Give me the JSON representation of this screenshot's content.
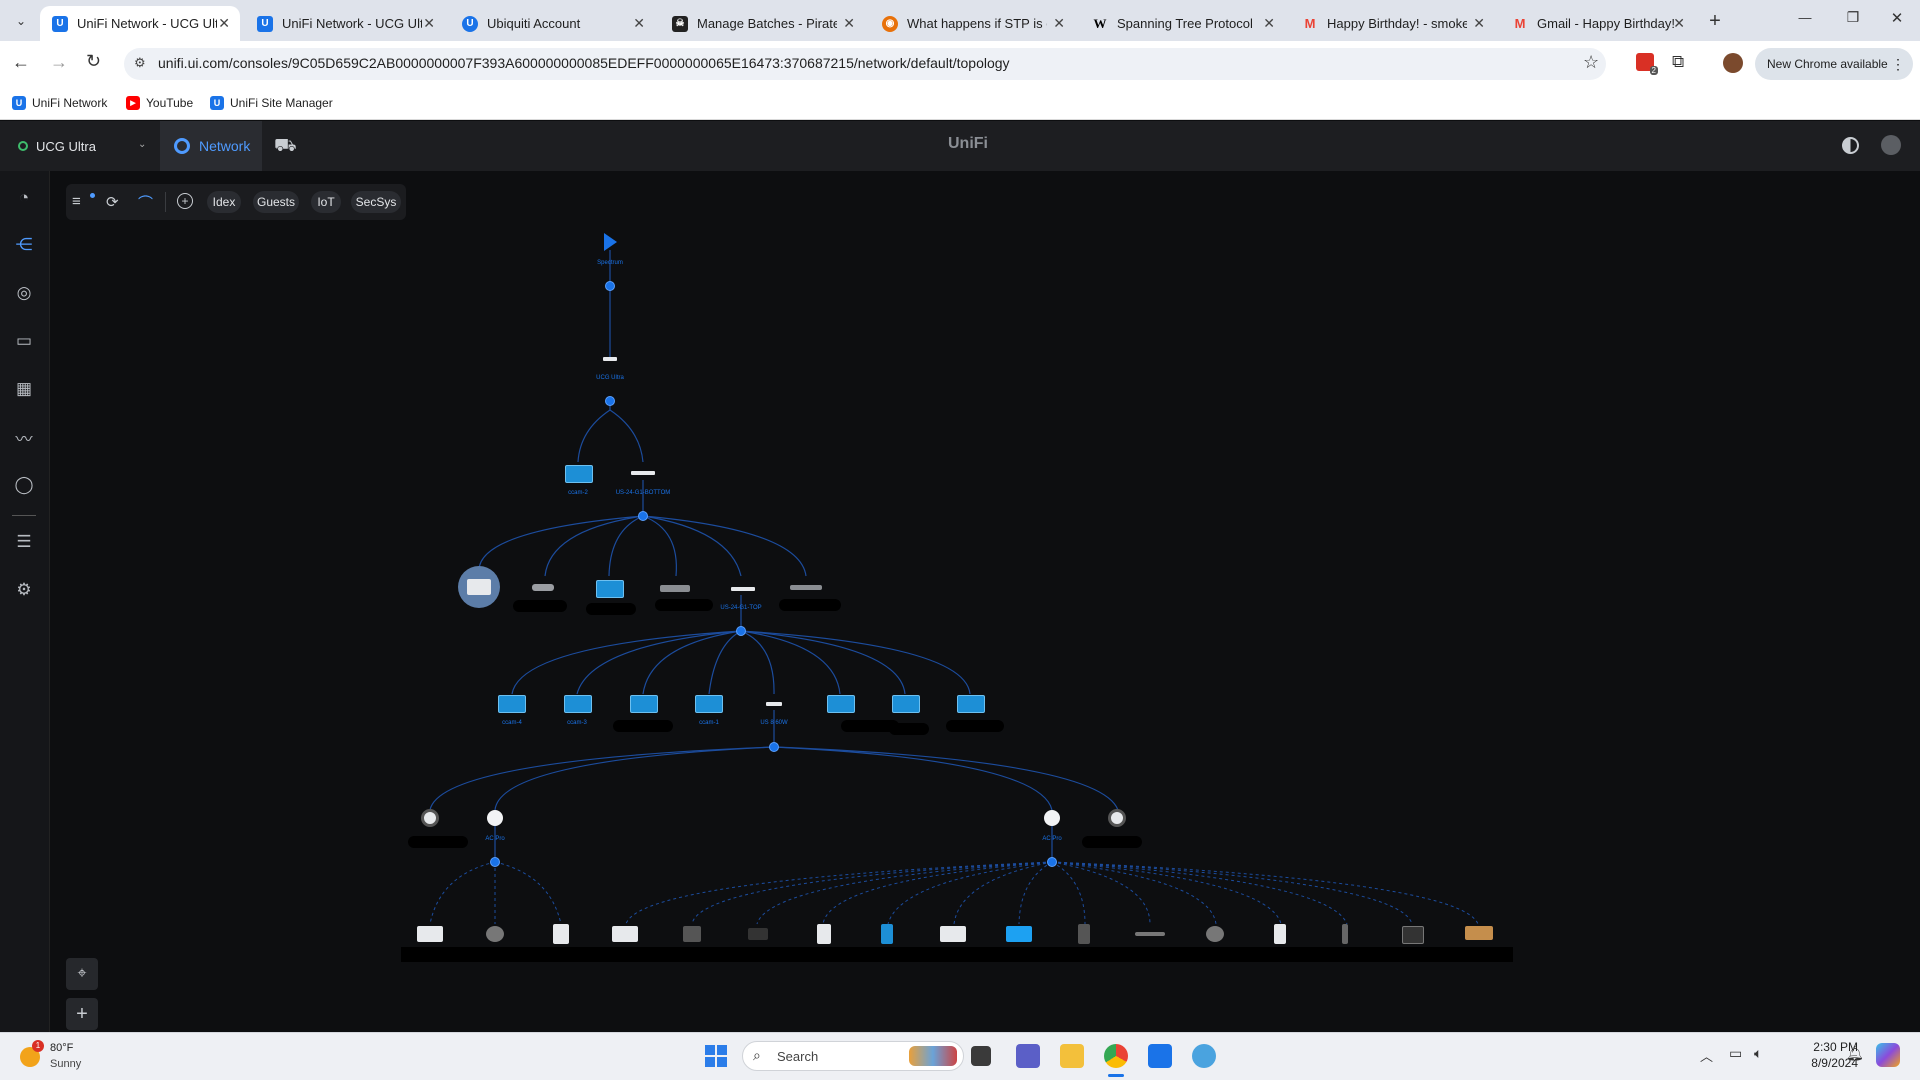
{
  "browser": {
    "tabs": [
      {
        "title": "UniFi Network - UCG Ultra",
        "icon": "unifi-icon",
        "color": "#1a73e8",
        "active": true
      },
      {
        "title": "UniFi Network - UCG Ultra",
        "icon": "unifi-icon",
        "color": "#1a73e8",
        "active": false
      },
      {
        "title": "Ubiquiti Account",
        "icon": "ubiquiti-icon",
        "color": "#1a73e8",
        "active": false
      },
      {
        "title": "Manage Batches - Pirate Ship",
        "icon": "pirate-icon",
        "color": "#222222",
        "active": false
      },
      {
        "title": "What happens if STP is enabled",
        "icon": "chat-icon",
        "color": "#e8710a",
        "active": false
      },
      {
        "title": "Spanning Tree Protocol - Wikipedia",
        "icon": "wikipedia-icon",
        "color": "#ffffff",
        "active": false
      },
      {
        "title": "Happy Birthday! - smokey",
        "icon": "gmail-icon",
        "color": "#ea4335",
        "active": false
      },
      {
        "title": "Gmail - Happy Birthday!",
        "icon": "gmail-icon",
        "color": "#ea4335",
        "active": false
      }
    ],
    "new_tab": "+",
    "window_controls": {
      "minimize": "—",
      "maximize": "❐",
      "close": "✕"
    },
    "url": "unifi.ui.com/consoles/9C05D659C2AB0000000007F393A600000000085EDEFF0000000065E16473:370687215/network/default/topology",
    "extension_badge": "2",
    "update_button": "New Chrome available",
    "bookmarks": [
      {
        "label": "UniFi Network",
        "color": "#1a73e8",
        "glyph": "U"
      },
      {
        "label": "YouTube",
        "color": "#ff0000",
        "glyph": "▶"
      },
      {
        "label": "UniFi Site Manager",
        "color": "#1a73e8",
        "glyph": "U"
      }
    ]
  },
  "app": {
    "console_name": "UCG Ultra",
    "app_name": "Network",
    "brand": "UniFi",
    "filters": [
      "Idex",
      "Guests",
      "IoT",
      "SecSys"
    ]
  },
  "topology": {
    "nodes": [
      {
        "id": "spectrum",
        "label": "Spectrum"
      },
      {
        "id": "ucg",
        "label": "UCG Ultra"
      },
      {
        "id": "cam2",
        "label": "ccam-2"
      },
      {
        "id": "sw_bottom",
        "label": "US-24-G1-BOTTOM"
      },
      {
        "id": "sw_top",
        "label": "US-24-G1-TOP"
      },
      {
        "id": "cam4",
        "label": "ccam-4"
      },
      {
        "id": "cam3",
        "label": "ccam-3"
      },
      {
        "id": "cam1",
        "label": "ccam-1"
      },
      {
        "id": "us8",
        "label": "US 8 60W"
      },
      {
        "id": "ap1",
        "label": "AC Pro"
      },
      {
        "id": "ap2",
        "label": "AC Pro"
      }
    ]
  },
  "taskbar": {
    "weather_temp": "80°F",
    "weather_desc": "Sunny",
    "weather_badge": "1",
    "search_placeholder": "Search",
    "time": "2:30 PM",
    "date": "8/9/2024"
  },
  "colors": {
    "accent": "#1a73e8",
    "link": "#0d5fd6",
    "background": "#0d0e10"
  }
}
